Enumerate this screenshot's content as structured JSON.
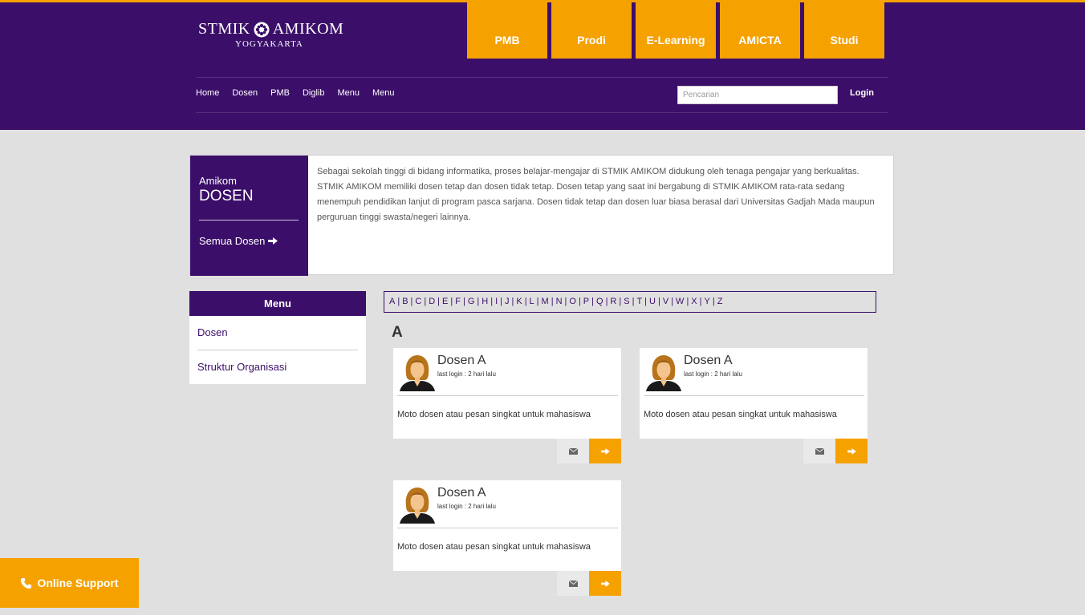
{
  "logo": {
    "line1_left": "STMIK",
    "line1_right": "AMIKOM",
    "line2": "YOGYAKARTA"
  },
  "topnav": [
    {
      "label": "PMB"
    },
    {
      "label": "Prodi"
    },
    {
      "label": "E-Learning"
    },
    {
      "label": "AMICTA"
    },
    {
      "label": "Studi"
    }
  ],
  "subnav": {
    "links": [
      {
        "label": "Home"
      },
      {
        "label": "Dosen"
      },
      {
        "label": "PMB"
      },
      {
        "label": "Diglib"
      },
      {
        "label": "Menu"
      },
      {
        "label": "Menu"
      }
    ],
    "search_placeholder": "Pencarian",
    "login_label": "Login"
  },
  "intro": {
    "brand": "Amikom",
    "title": "DOSEN",
    "all_link": "Semua Dosen",
    "text": "Sebagai sekolah tinggi di bidang informatika, proses belajar-mengajar di STMIK AMIKOM didukung oleh tenaga pengajar yang berkualitas. STMIK AMIKOM memiliki dosen tetap dan dosen tidak tetap. Dosen tetap yang saat ini bergabung di STMIK AMIKOM rata-rata sedang menempuh pendidikan lanjut di program pasca sarjana. Dosen tidak tetap dan dosen luar biasa berasal dari Universitas Gadjah Mada maupun perguruan tinggi swasta/negeri lainnya."
  },
  "side_menu": {
    "header": "Menu",
    "items": [
      {
        "label": "Dosen"
      },
      {
        "label": "Struktur Organisasi"
      }
    ]
  },
  "alphabet": [
    "A",
    "B",
    "C",
    "D",
    "E",
    "F",
    "G",
    "H",
    "I",
    "J",
    "K",
    "L",
    "M",
    "N",
    "O",
    "P",
    "Q",
    "R",
    "S",
    "T",
    "U",
    "V",
    "W",
    "X",
    "Y",
    "Z"
  ],
  "section_letter": "A",
  "cards": [
    {
      "name": "Dosen A",
      "last_login": "last login : 2 hari lalu",
      "moto": "Moto dosen atau pesan singkat untuk mahasiswa"
    },
    {
      "name": "Dosen A",
      "last_login": "last login : 2 hari lalu",
      "moto": "Moto dosen atau pesan singkat untuk mahasiswa"
    },
    {
      "name": "Dosen A",
      "last_login": "last login : 2 hari lalu",
      "moto": "Moto dosen atau pesan singkat untuk mahasiswa"
    }
  ],
  "support": {
    "label": "Online Support"
  },
  "colors": {
    "primary": "#3b0e69",
    "accent": "#f5a100",
    "background": "#e0e0e0"
  },
  "icons": {
    "emblem": "flower-emblem-icon",
    "arrow": "arrow-right-icon",
    "mail": "mail-icon",
    "phone": "phone-icon",
    "avatar": "female-avatar-icon"
  }
}
